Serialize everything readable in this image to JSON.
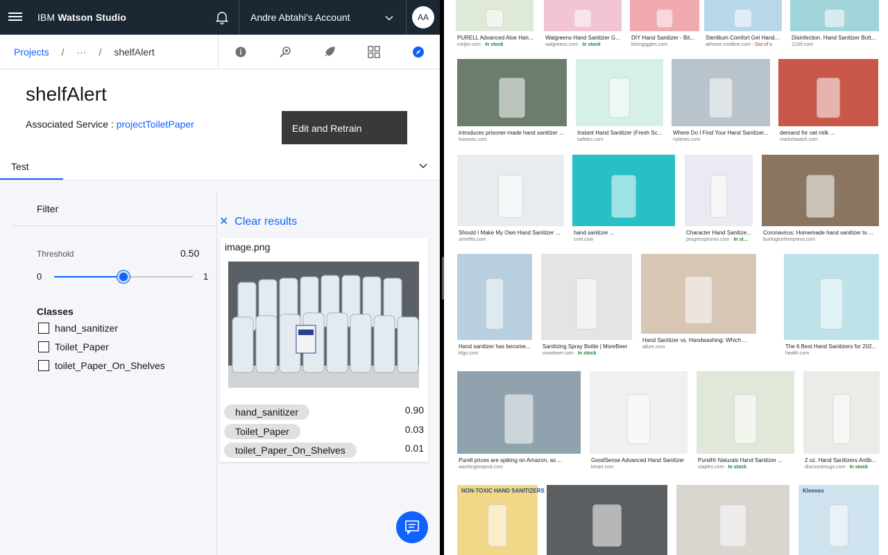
{
  "header": {
    "brand_prefix": "IBM",
    "brand_name": "Watson Studio",
    "account": "Andre Abtahi's Account",
    "avatar": "AA",
    "icons": [
      "menu-icon",
      "notification-icon",
      "chevron-down-icon"
    ]
  },
  "breadcrumb": {
    "root": "Projects",
    "sep": "/",
    "middle": "···",
    "current": "shelfAlert",
    "tool_icons": [
      "info-icon",
      "search-model-icon",
      "deploy-icon",
      "grid-icon",
      "compass-icon"
    ]
  },
  "model": {
    "title": "shelfAlert",
    "assoc_label": "Associated Service : ",
    "assoc_link": "projectToiletPaper",
    "edit_button": "Edit and Retrain"
  },
  "test": {
    "tab_label": "Test",
    "filter_label": "Filter",
    "threshold_label": "Threshold",
    "threshold_value": "0.50",
    "threshold_fraction": 0.5,
    "min": "0",
    "max": "1",
    "classes_label": "Classes",
    "classes": [
      "hand_sanitizer",
      "Toilet_Paper",
      "toilet_Paper_On_Shelves"
    ]
  },
  "results": {
    "clear_label": "Clear results",
    "image_name": "image.png",
    "scores": [
      {
        "label": "hand_sanitizer",
        "score": "0.90"
      },
      {
        "label": "Toilet_Paper",
        "score": "0.03"
      },
      {
        "label": "toilet_Paper_On_Shelves",
        "score": "0.01"
      }
    ]
  },
  "search_results": [
    {
      "caption": "PURELL Advanced Aloe Han...",
      "source": "meijer.com",
      "stock": "In stock",
      "color": "#dfe9d7"
    },
    {
      "caption": "Walgreens Hand Sanitizer G...",
      "source": "walgreens.com",
      "stock": "In stock",
      "color": "#f2c4d4"
    },
    {
      "caption": "DIY Hand Sanitizer - Bit...",
      "source": "bitzngiggles.com",
      "stock": "",
      "color": "#f1a9b0"
    },
    {
      "caption": "Sterillium Comfort Gel Hand...",
      "source": "athome.medline.com",
      "stock": "Out of s",
      "color": "#b8d8ea"
    },
    {
      "caption": "Disinfection. Hand Sanitizer Bott...",
      "source": "123rf.com",
      "stock": "",
      "color": "#9fd4d8"
    },
    {
      "caption": "introduces prisoner-made hand sanitizer ...",
      "source": "foxnews.com",
      "stock": "",
      "color": "#6b7d6c"
    },
    {
      "caption": "Instant Hand Sanitizer (Fresh Sc...",
      "source": "safetec.com",
      "stock": "",
      "color": "#d7efe9"
    },
    {
      "caption": "Where Do I Find Your Hand Sanitizer...",
      "source": "nytimes.com",
      "stock": "",
      "color": "#b9c3cc"
    },
    {
      "caption": "demand for oat milk ...",
      "source": "marketwatch.com",
      "stock": "",
      "color": "#c9584a"
    },
    {
      "caption": "Should I Make My Own Hand Sanitizer ...",
      "source": "zenefits.com",
      "stock": "",
      "color": "#e8ecef"
    },
    {
      "caption": "hand sanitizer ...",
      "source": "cnet.com",
      "stock": "",
      "color": "#27c0c4"
    },
    {
      "caption": "Character Hand Sanitize...",
      "source": "progresspromo.com",
      "stock": "In st...",
      "color": "#eaeaf2"
    },
    {
      "caption": "Coronavirus: Homemade hand sanitizer to ...",
      "source": "burlingtonfreepress.com",
      "stock": "",
      "color": "#8a7560"
    },
    {
      "caption": "Hand sanitizer has become...",
      "source": "kfgo.com",
      "stock": "",
      "color": "#b8cfe0"
    },
    {
      "caption": "Sanitizing Spray Bottle | MoreBeer",
      "source": "morebeer.com",
      "stock": "In stock",
      "color": "#e4e4e4"
    },
    {
      "caption": "Hand Sanitizer vs. Handwashing: Which ...",
      "source": "allure.com",
      "stock": "",
      "color": "#d8c6b4"
    },
    {
      "caption": "The 6 Best Hand Sanitizers for 202...",
      "source": "health.com",
      "stock": "",
      "color": "#bde3ea"
    },
    {
      "caption": "Purell prices are spiking on Amazon, as ...",
      "source": "washingtonpost.com",
      "stock": "",
      "color": "#8fa2ae"
    },
    {
      "caption": "GoodSense Advanced Hand Sanitizer",
      "source": "kmart.com",
      "stock": "",
      "color": "#eef0f1"
    },
    {
      "caption": "Purell® Naturals Hand Sanitizer ...",
      "source": "staples.com",
      "stock": "In stock",
      "color": "#dfe8d9"
    },
    {
      "caption": "2 oz. Hand Sanitizers Antib...",
      "source": "discountmugs.com",
      "stock": "In stock",
      "color": "#ecebe7"
    },
    {
      "caption": "NON-TOXIC HAND SANITIZERS",
      "source": "",
      "stock": "",
      "color": "#f3d788"
    },
    {
      "caption": "",
      "source": "",
      "stock": "",
      "color": "#5c5f62"
    },
    {
      "caption": "",
      "source": "",
      "stock": "",
      "color": "#d9d6d0"
    },
    {
      "caption": "Kleenex",
      "source": "",
      "stock": "",
      "color": "#cfe3ee"
    }
  ]
}
